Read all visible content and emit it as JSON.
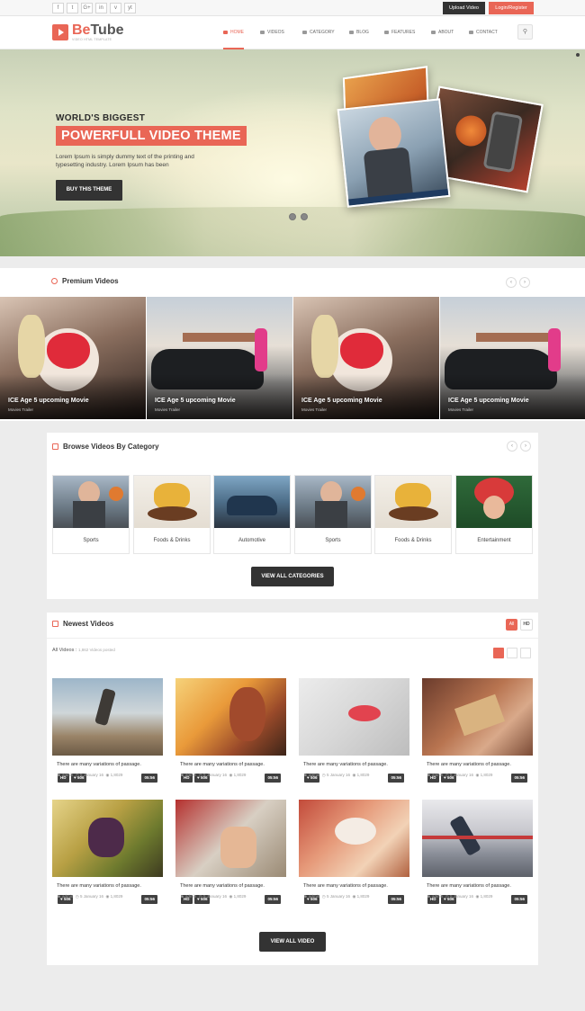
{
  "topbar": {
    "social": [
      "f",
      "t",
      "G+",
      "in",
      "v",
      "yt"
    ],
    "upload_label": "Upload Video",
    "login_label": "Login/Register"
  },
  "header": {
    "logo_be": "Be",
    "logo_tube": "Tube",
    "logo_tagline": "VIDEO HTML TEMPLATE",
    "nav": [
      {
        "label": "HOME",
        "icon": "home-icon"
      },
      {
        "label": "VIDEOS",
        "icon": "film-icon"
      },
      {
        "label": "CATEGORY",
        "icon": "th-icon"
      },
      {
        "label": "BLOG",
        "icon": "edit-icon"
      },
      {
        "label": "FEATURES",
        "icon": "magic-icon"
      },
      {
        "label": "ABOUT",
        "icon": "user-icon"
      },
      {
        "label": "CONTACT",
        "icon": "envelope-icon"
      }
    ]
  },
  "hero": {
    "kicker": "WORLD'S BIGGEST",
    "headline": "POWERFULL VIDEO THEME",
    "description": "Lorem Ipsum is simply dummy text of the printing and typesetting industry. Lorem Ipsum has been",
    "button": "BUY THIS THEME"
  },
  "premium": {
    "title": "Premium Videos",
    "items": [
      {
        "title": "ICE Age 5 upcoming Movie",
        "subtitle": "Movies Trailer"
      },
      {
        "title": "ICE Age 5 upcoming Movie",
        "subtitle": "Movies Trailer"
      },
      {
        "title": "ICE Age 5 upcoming Movie",
        "subtitle": "Movies Trailer"
      },
      {
        "title": "ICE Age 5 upcoming Movie",
        "subtitle": "Movies Trailer"
      }
    ]
  },
  "category": {
    "title": "Browse Videos By Category",
    "items": [
      "Sports",
      "Foods & Drinks",
      "Automotive",
      "Sports",
      "Foods & Drinks",
      "Entertainment"
    ],
    "button": "VIEW ALL CATEGORIES"
  },
  "newest": {
    "title": "Newest Videos",
    "filter_all": "All",
    "filter_hd": "HD",
    "all_videos_label": "All Videos :",
    "videos_count": "1,862 Videos posted",
    "item_title": "There are many variations of passage.",
    "meta_author": "admin",
    "meta_date": "5 January 16",
    "meta_views": "1,8029",
    "hd_badge": "HD",
    "likes": "506",
    "durations": [
      "05:56",
      "05:56",
      "05:56",
      "05:56",
      "05:56",
      "05:56",
      "05:56",
      "05:56"
    ],
    "button": "VIEW ALL VIDEO"
  },
  "colors": {
    "accent": "#e96656",
    "dark": "#333333"
  }
}
